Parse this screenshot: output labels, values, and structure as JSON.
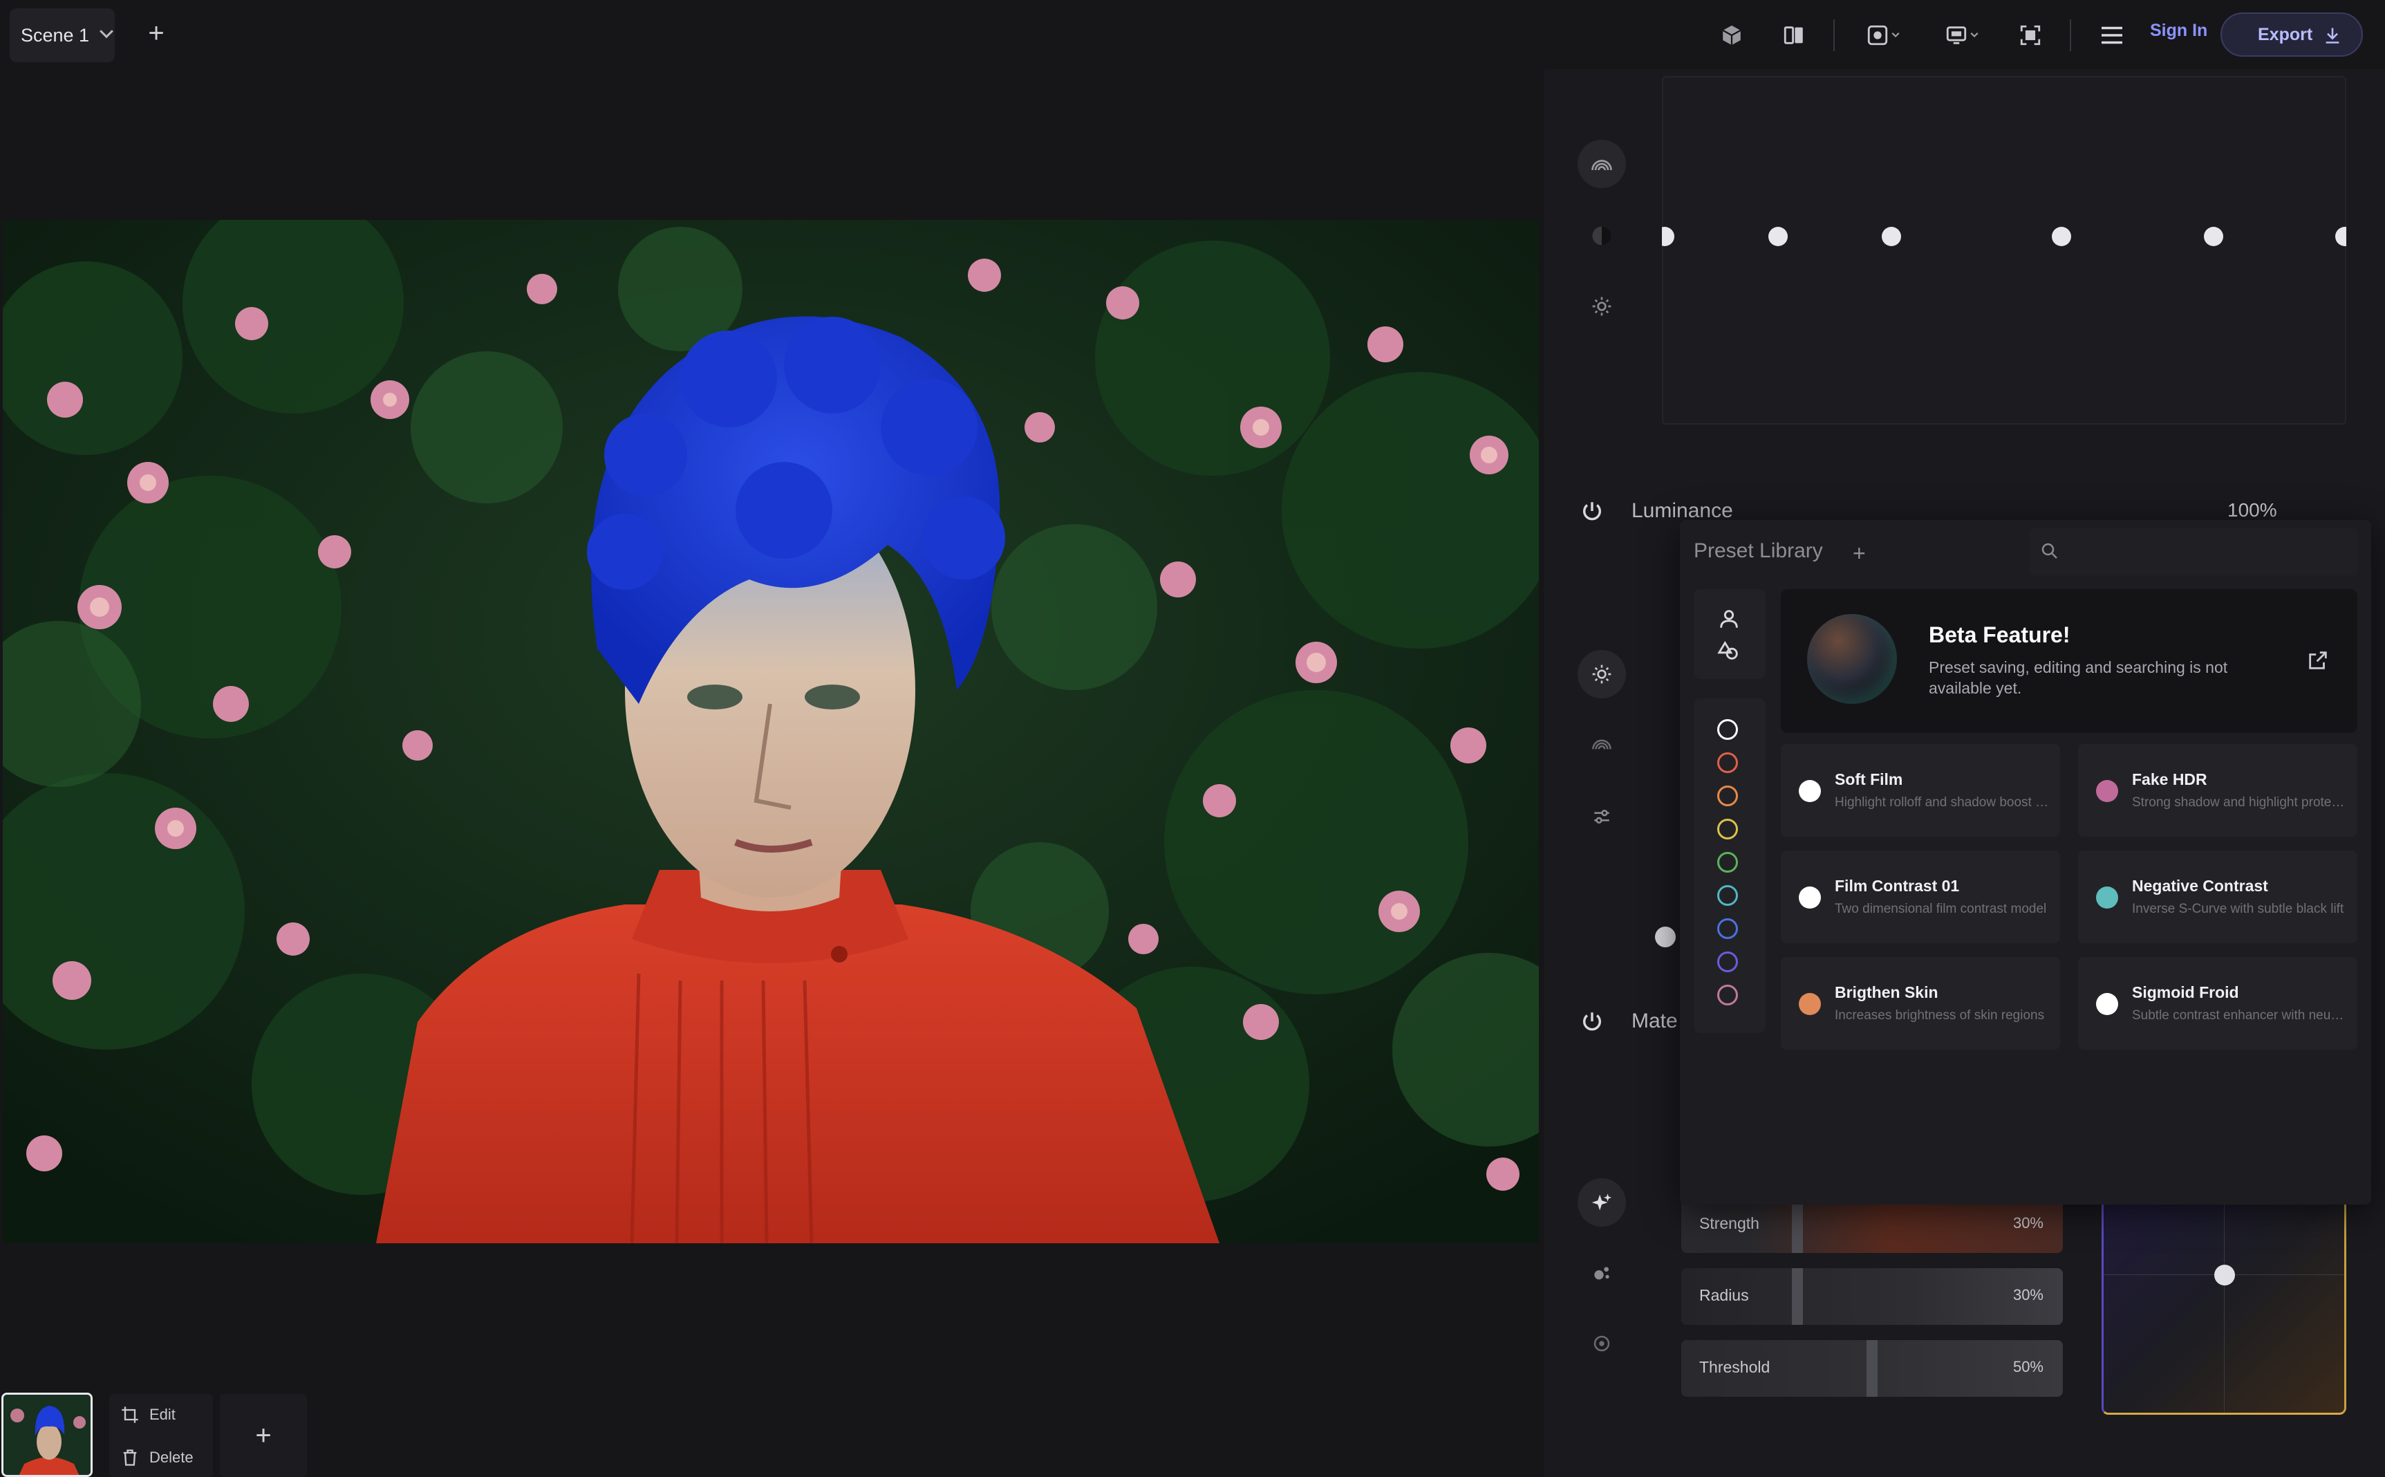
{
  "topbar": {
    "scene_tab": "Scene 1",
    "sign_in": "Sign In",
    "export": "Export"
  },
  "panels": {
    "luminance_title": "Luminance",
    "luminance_pct": "100%",
    "material_title": "Mate"
  },
  "preset_library": {
    "title": "Preset Library",
    "search_placeholder": "",
    "beta": {
      "title": "Beta Feature!",
      "desc": "Preset saving, editing and searching is not available yet."
    },
    "color_filters": [
      "#ffffff",
      "#e0604a",
      "#e58a4a",
      "#d9c24a",
      "#5cb35c",
      "#4fb9c4",
      "#4a72e0",
      "#6a5be0",
      "#c07aa0"
    ],
    "presets": [
      {
        "title": "Soft Film",
        "desc": "Highlight rolloff and shadow boost for a soft look",
        "color": "#ffffff"
      },
      {
        "title": "Fake HDR",
        "desc": "Strong shadow and highlight protection",
        "color": "#c06b9b"
      },
      {
        "title": "Film Contrast 01",
        "desc": "Two dimensional film contrast model",
        "color": "#ffffff"
      },
      {
        "title": "Negative Contrast",
        "desc": "Inverse S-Curve with subtle black lift",
        "color": "#5fbdbd"
      },
      {
        "title": "Brigthen Skin",
        "desc": "Increases brightness of skin regions",
        "color": "#e08a5a"
      },
      {
        "title": "Sigmoid Froid",
        "desc": "Subtle contrast enhancer with neutral tones",
        "color": "#ffffff"
      }
    ]
  },
  "sliders": [
    {
      "label": "Strength",
      "value": "30%",
      "level": 0.3
    },
    {
      "label": "Radius",
      "value": "30%",
      "level": 0.3
    },
    {
      "label": "Threshold",
      "value": "50%",
      "level": 0.5
    }
  ],
  "filmstrip": {
    "edit": "Edit",
    "delete": "Delete"
  },
  "colors": {
    "accent": "#8b93ff",
    "bg": "#161619"
  }
}
